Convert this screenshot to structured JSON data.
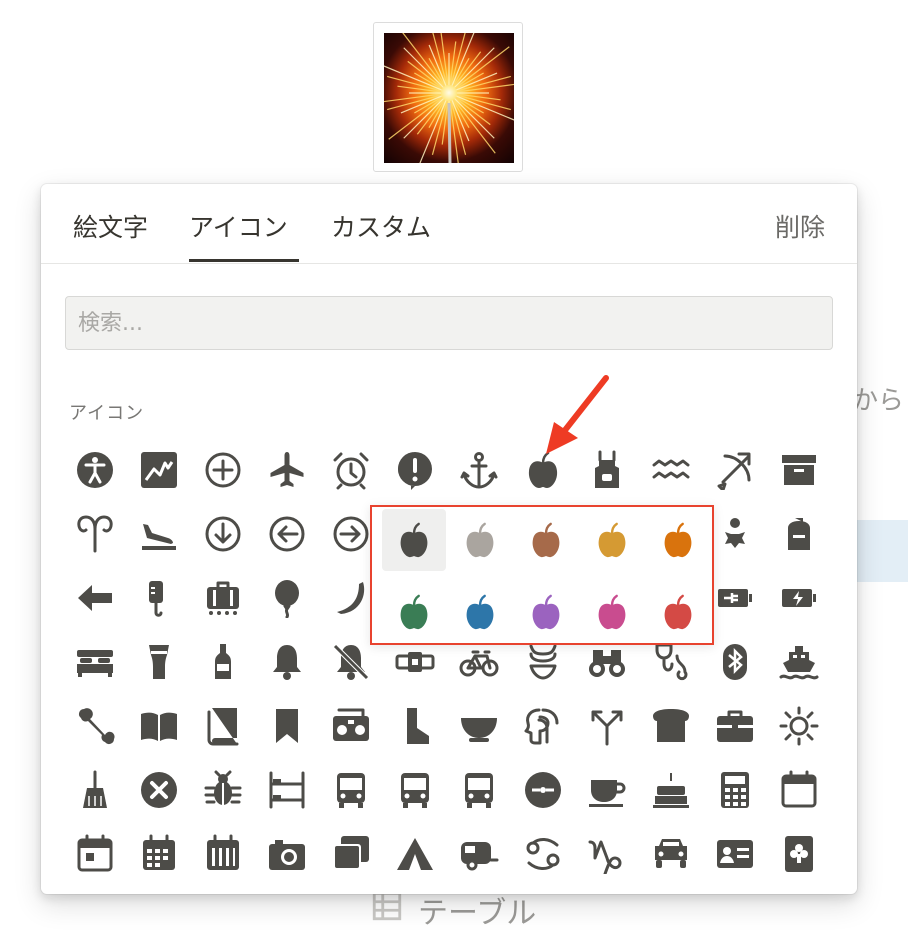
{
  "background": {
    "right_text": "から",
    "bottom_label": "テーブル"
  },
  "picker": {
    "tabs": [
      "絵文字",
      "アイコン",
      "カスタム"
    ],
    "active_tab": "アイコン",
    "remove_label": "削除",
    "search_placeholder": "検索...",
    "section_label": "アイコン",
    "icon_color": "#4d4c48",
    "icon_rows": [
      [
        "accessibility-icon",
        "chart-icon",
        "add-circle-icon",
        "airplane-icon",
        "alarm-icon",
        "alert-icon",
        "anchor-icon",
        "apple-icon",
        "apron-icon",
        "aquarius-icon",
        "archery-icon",
        "archive-icon"
      ],
      [
        "aries-icon",
        "arrival-icon",
        "arrow-down-circle-icon",
        "arrow-left-circle-icon",
        "arrow-right-circle-icon",
        "",
        "",
        "",
        "",
        "",
        "baby-icon",
        "backpack-icon"
      ],
      [
        "arrow-left-icon",
        "iv-bag-icon",
        "baggage-icon",
        "balloon-icon",
        "banana-icon",
        "",
        "",
        "",
        "",
        "",
        "battery-plug-icon",
        "battery-charging-icon"
      ],
      [
        "bed-icon",
        "beer-icon",
        "bottle-icon",
        "bell-icon",
        "bell-off-icon",
        "belt-icon",
        "bicycle-icon",
        "bikini-icon",
        "binoculars-icon",
        "biometric-icon",
        "bluetooth-icon",
        "boat-icon"
      ],
      [
        "bone-icon",
        "book-open-icon",
        "book-icon",
        "bookmark-icon",
        "boombox-icon",
        "boot-icon",
        "bowl-icon",
        "brain-icon",
        "branch-icon",
        "bread-icon",
        "briefcase-icon",
        "brightness-icon"
      ],
      [
        "broom-icon",
        "remove-circle-icon",
        "bug-icon",
        "bunk-bed-icon",
        "bus-icon",
        "bus-2-icon",
        "bus-3-icon",
        "button-icon",
        "cafe-icon",
        "cake-icon",
        "calculator-icon",
        "calendar-icon"
      ],
      [
        "calendar-day-icon",
        "calendar-grid-icon",
        "calendar-month-icon",
        "camera-icon",
        "cards-icon",
        "camping-tent-icon",
        "caravan-icon",
        "cancer-icon",
        "capricorn-icon",
        "car-icon",
        "id-card-icon",
        "clubs-card-icon"
      ]
    ],
    "color_variants": [
      [
        "#4d4c48",
        "#aaa59f",
        "#a66a4a",
        "#d59a33",
        "#d9730d"
      ],
      [
        "#3a7d55",
        "#2d76a9",
        "#9b63bf",
        "#c94c8f",
        "#d44a45"
      ]
    ],
    "selected_variant": "#4d4c48"
  }
}
